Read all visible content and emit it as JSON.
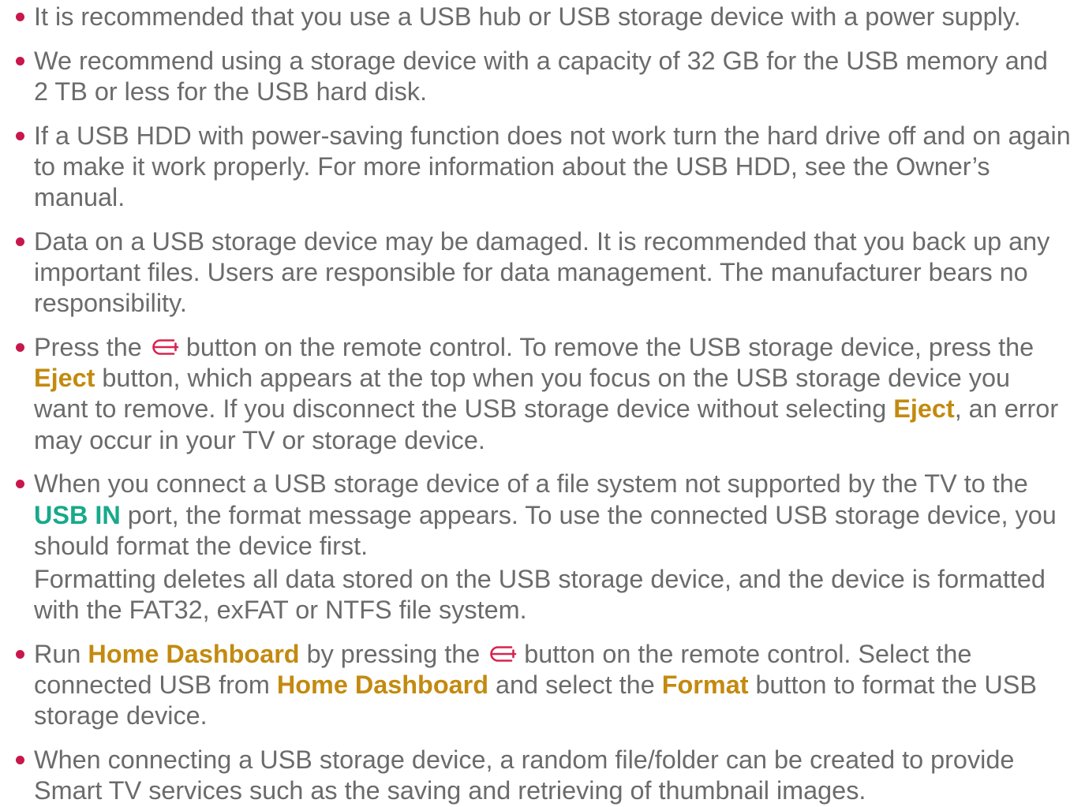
{
  "colors": {
    "text": "#6b6b6b",
    "bullet": "#c8174b",
    "highlight": "#c38a0f",
    "port_label": "#17a98a",
    "icon": "#d8234f"
  },
  "icons": [
    "home-button-icon",
    "bullet-icon"
  ],
  "items": [
    {
      "lines": [
        "It is recommended that you use a USB hub or USB storage device with a power supply."
      ]
    },
    {
      "lines": [
        "We recommend using a storage device with a capacity of 32 GB for the USB memory and",
        "2 TB or less for the USB hard disk."
      ]
    },
    {
      "lines": [
        "If a USB HDD with power-saving function does not work turn the hard drive off and on again",
        "to make it work properly. For more information about the USB HDD, see the Owner’s",
        "manual."
      ]
    },
    {
      "lines": [
        "Data on a USB storage device may be damaged. It is recommended that you back up any",
        "important files. Users are responsible for data management. The manufacturer bears no",
        "responsibility."
      ]
    },
    {
      "lines": [
        [
          "Press the ",
          " button on the remote control. To remove the USB storage device, press the"
        ],
        [
          "Eject",
          " button, which appears at the top when you focus on the USB storage device you"
        ],
        [
          "want to remove. If you disconnect the USB storage device without selecting ",
          "Eject",
          ", an error"
        ],
        [
          "may occur in your TV or storage device."
        ]
      ]
    },
    {
      "lines": [
        [
          "When you connect a USB storage device of a file system not supported by the TV to the"
        ],
        [
          "USB IN",
          " port, the format message appears. To use the connected USB storage device, you"
        ],
        [
          "should format the device first."
        ]
      ],
      "note_lines": [
        "Formatting deletes all data stored on the USB storage device, and the device is formatted",
        "with the FAT32, exFAT or NTFS file system."
      ]
    },
    {
      "lines": [
        [
          "Run ",
          "Home Dashboard",
          " by pressing the ",
          " button on the remote control. Select the"
        ],
        [
          "connected USB from ",
          "Home Dashboard",
          " and select the ",
          "Format",
          " button to format the USB"
        ],
        [
          "storage device."
        ]
      ]
    },
    {
      "lines": [
        "When connecting a USB storage device, a random file/folder can be created to provide",
        "Smart TV services such as the saving and retrieving of thumbnail images."
      ]
    }
  ]
}
